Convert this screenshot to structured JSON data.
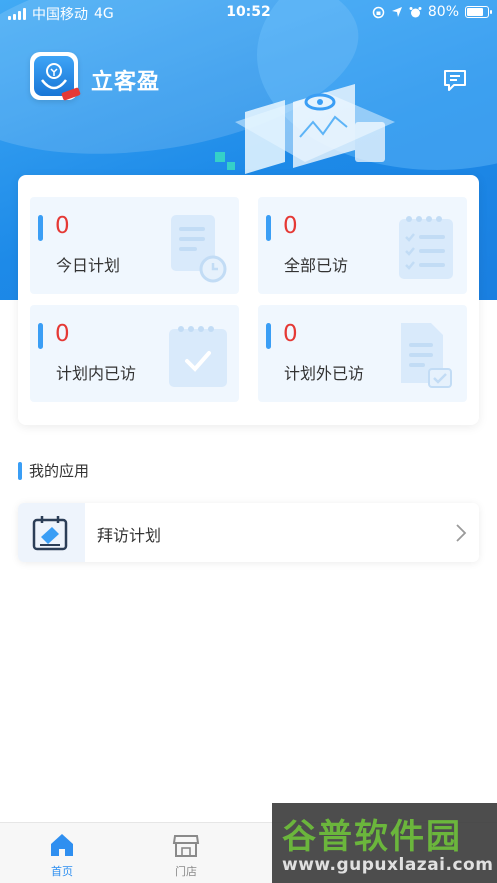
{
  "status_bar": {
    "carrier": "中国移动",
    "network": "4G",
    "time": "10:52",
    "battery": "80%",
    "battery_level": 0.8
  },
  "header": {
    "app_title": "立客盈"
  },
  "stats": [
    {
      "value": "0",
      "label": "今日计划",
      "icon": "document-clock-icon"
    },
    {
      "value": "0",
      "label": "全部已访",
      "icon": "checklist-icon"
    },
    {
      "value": "0",
      "label": "计划内已访",
      "icon": "calendar-check-icon"
    },
    {
      "value": "0",
      "label": "计划外已访",
      "icon": "document-check-icon"
    }
  ],
  "my_apps": {
    "title": "我的应用",
    "items": [
      {
        "label": "拜访计划",
        "icon": "calendar-visit-icon"
      }
    ]
  },
  "tabbar": {
    "tabs": [
      {
        "label": "首页",
        "icon": "home-icon",
        "active": true
      },
      {
        "label": "门店",
        "icon": "store-icon",
        "active": false
      }
    ]
  },
  "watermark": {
    "title": "谷普软件园",
    "url": "www.gupuxlazai.com"
  },
  "colors": {
    "accent": "#3a9ef5",
    "value_red": "#e53935",
    "header_blue": "#1d8ae8"
  }
}
